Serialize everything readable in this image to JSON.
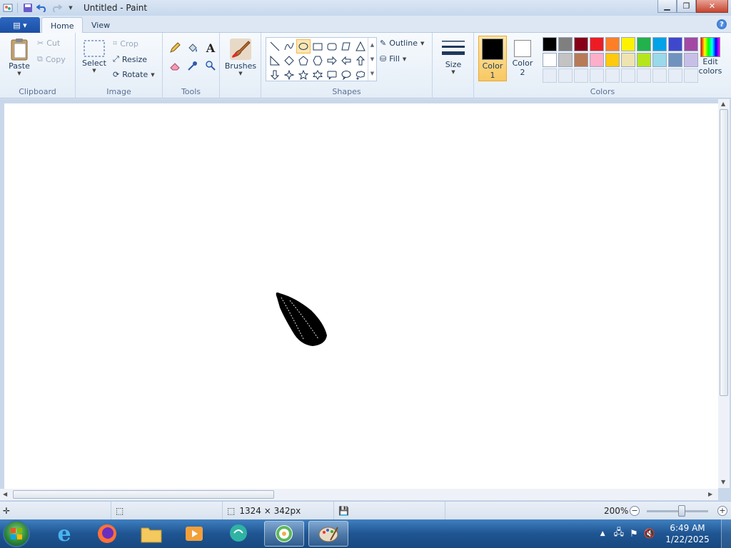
{
  "window": {
    "title": "Untitled - Paint"
  },
  "tabs": {
    "home": "Home",
    "view": "View"
  },
  "clipboard": {
    "paste": "Paste",
    "cut": "Cut",
    "copy": "Copy",
    "label": "Clipboard"
  },
  "image": {
    "select": "Select",
    "crop": "Crop",
    "resize": "Resize",
    "rotate": "Rotate",
    "label": "Image"
  },
  "tools": {
    "label": "Tools",
    "items": [
      "pencil-icon",
      "fill-icon",
      "text-icon",
      "eraser-icon",
      "color-picker-icon",
      "magnifier-icon"
    ]
  },
  "brushes": {
    "label": "Brushes"
  },
  "shapes": {
    "label": "Shapes",
    "outline": "Outline",
    "fill": "Fill"
  },
  "size": {
    "label": "Size"
  },
  "colors": {
    "label": "Colors",
    "color1_label": "Color",
    "color1_num": "1",
    "color2_label": "Color",
    "color2_num": "2",
    "edit_label": "Edit",
    "edit_label2": "colors",
    "color1": "#000000",
    "color2": "#ffffff",
    "palette_row1": [
      "#000000",
      "#7f7f7f",
      "#880015",
      "#ed1c24",
      "#ff7f27",
      "#fff200",
      "#22b14c",
      "#00a2e8",
      "#3f48cc",
      "#a349a4"
    ],
    "palette_row2": [
      "#ffffff",
      "#c3c3c3",
      "#b97a57",
      "#ffaec9",
      "#ffc90e",
      "#efe4b0",
      "#b5e61d",
      "#99d9ea",
      "#7092be",
      "#c8bfe7"
    ]
  },
  "status": {
    "canvas_size": "1324 × 342px",
    "zoom": "200%"
  },
  "taskbar": {
    "time": "6:49 AM",
    "date": "1/22/2025"
  }
}
